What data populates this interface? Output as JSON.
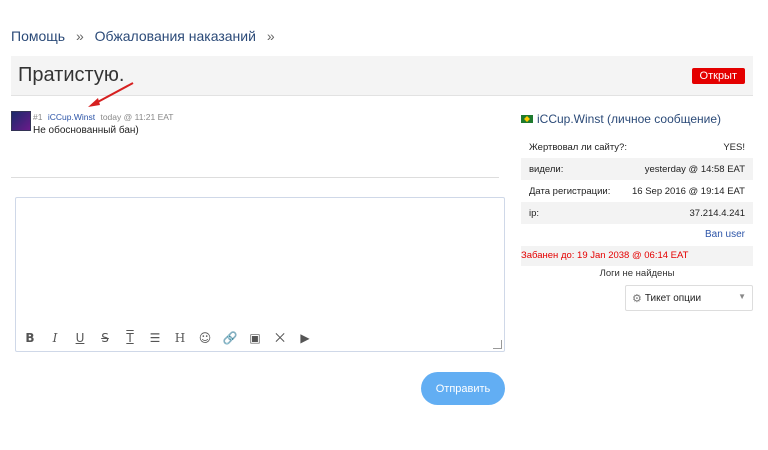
{
  "breadcrumb": {
    "items": [
      "Помощь",
      "Обжалования наказаний"
    ],
    "sep": "»"
  },
  "title": "Пратистую.",
  "status": "Открыт",
  "post": {
    "number": "#1",
    "author": "iCCup.Winst",
    "time": "today @ 11:21 EAT",
    "body": "Не обоснованный бан)"
  },
  "submit_label": "Отправить",
  "sidebar": {
    "profile_name": "iCCup.Winst (личное сообщение)",
    "rows": [
      {
        "label": "Жертвовал ли сайту?:",
        "value": "YES!"
      },
      {
        "label": "видели:",
        "value": "yesterday @ 14:58 EAT"
      },
      {
        "label": "Дата регистрации:",
        "value": "16 Sep 2016 @ 19:14 EAT"
      },
      {
        "label": "ip:",
        "value": "37.214.4.241"
      }
    ],
    "ban_user": "Ban user",
    "ban_text": "Забанен до: 19 Jan 2038 @ 06:14 EAT",
    "logs": "Логи не найдены",
    "ticket_options": "Тикет опции"
  },
  "toolbar_icons": [
    "bold-icon",
    "italic-icon",
    "underline-icon",
    "strikethrough-icon",
    "text-icon",
    "list-icon",
    "heading-icon",
    "emoji-icon",
    "link-icon",
    "image-icon",
    "collapse-icon",
    "video-icon"
  ],
  "colors": {
    "accent": "#2b4a78",
    "status": "#e40000",
    "submit": "#62aef3"
  }
}
